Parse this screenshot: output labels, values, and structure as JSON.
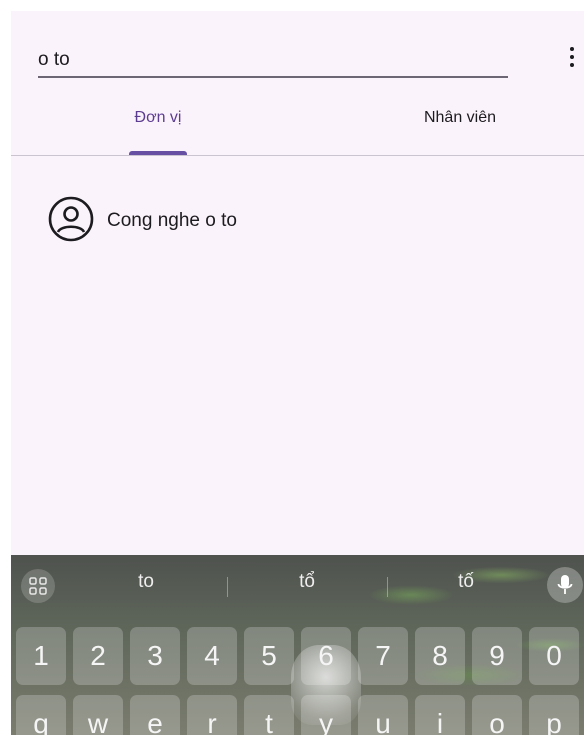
{
  "search": {
    "value": "o to",
    "menu_icon": "more-vert-icon"
  },
  "tabs": [
    {
      "label": "Đơn vị",
      "selected": true
    },
    {
      "label": "Nhân viên",
      "selected": false
    }
  ],
  "results": [
    {
      "label": "Cong nghe o to",
      "icon": "account-circle-icon"
    }
  ],
  "keyboard": {
    "suggestions": [
      "to",
      "tổ",
      "tố"
    ],
    "number_row": [
      "1",
      "2",
      "3",
      "4",
      "5",
      "6",
      "7",
      "8",
      "9",
      "0"
    ],
    "letter_row": [
      "q",
      "w",
      "e",
      "r",
      "t",
      "y",
      "u",
      "i",
      "o",
      "p"
    ],
    "icons": {
      "left": "apps-grid-icon",
      "right": "microphone-icon"
    }
  },
  "colors": {
    "background": "#fbf3fb",
    "accent": "#6750a4",
    "selected_tab_text": "#5c3d91"
  }
}
